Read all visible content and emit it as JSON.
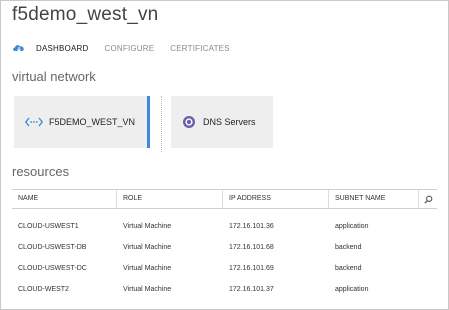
{
  "page": {
    "title": "f5demo_west_vn"
  },
  "nav": {
    "items": [
      {
        "label": "DASHBOARD",
        "active": true
      },
      {
        "label": "CONFIGURE",
        "active": false
      },
      {
        "label": "CERTIFICATES",
        "active": false
      }
    ]
  },
  "sections": {
    "virtual_network": "virtual network",
    "resources": "resources"
  },
  "tiles": {
    "vn": {
      "label": "F5DEMO_WEST_VN",
      "icon": "network-icon"
    },
    "dns": {
      "label": "DNS Servers",
      "icon": "dns-icon"
    }
  },
  "table": {
    "headers": [
      "NAME",
      "ROLE",
      "IP ADDRESS",
      "SUBNET NAME"
    ],
    "rows": [
      {
        "name": "CLOUD-USWEST1",
        "role": "Virtual Machine",
        "ip": "172.16.101.36",
        "subnet": "application"
      },
      {
        "name": "CLOUD-USWEST-DB",
        "role": "Virtual Machine",
        "ip": "172.16.101.68",
        "subnet": "backend"
      },
      {
        "name": "CLOUD-USWEST-DC",
        "role": "Virtual Machine",
        "ip": "172.16.101.69",
        "subnet": "backend"
      },
      {
        "name": "CLOUD-WEST2",
        "role": "Virtual Machine",
        "ip": "172.16.101.37",
        "subnet": "application"
      }
    ]
  },
  "colors": {
    "accent": "#3e8ad8",
    "dns_accent": "#6b5fa8",
    "tile_bg": "#eeeeee"
  }
}
